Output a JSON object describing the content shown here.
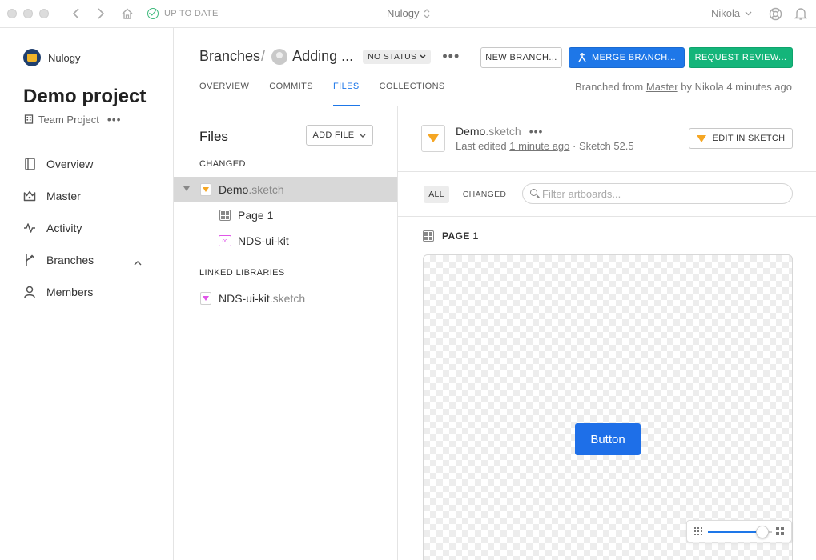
{
  "titlebar": {
    "status": "UP TO DATE",
    "org_name": "Nulogy",
    "user_name": "Nikola"
  },
  "sidebar": {
    "org_name": "Nulogy",
    "project_title": "Demo project",
    "project_type": "Team Project",
    "nav": [
      {
        "label": "Overview",
        "icon": "document-icon"
      },
      {
        "label": "Master",
        "icon": "crown-icon"
      },
      {
        "label": "Activity",
        "icon": "activity-icon"
      },
      {
        "label": "Branches",
        "icon": "branch-icon"
      },
      {
        "label": "Members",
        "icon": "person-icon"
      }
    ]
  },
  "header": {
    "breadcrumb_root": "Branches",
    "breadcrumb_branch": "Adding ...",
    "status_label": "NO STATUS",
    "new_branch_label": "NEW BRANCH...",
    "merge_branch_label": "MERGE BRANCH...",
    "request_review_label": "REQUEST REVIEW...",
    "tabs": [
      "OVERVIEW",
      "COMMITS",
      "FILES",
      "COLLECTIONS"
    ],
    "active_tab": "FILES",
    "branched_prefix": "Branched from",
    "branched_source": "Master",
    "branched_suffix": "by Nikola 4 minutes ago"
  },
  "files_panel": {
    "title": "Files",
    "add_file_label": "ADD FILE",
    "changed_label": "CHANGED",
    "changed_file": {
      "name": "Demo",
      "ext": ".sketch"
    },
    "children": [
      {
        "label": "Page 1",
        "icon": "page-icon"
      },
      {
        "label": "NDS-ui-kit",
        "icon": "link-icon"
      }
    ],
    "linked_label": "LINKED LIBRARIES",
    "linked_file": {
      "name": "NDS-ui-kit",
      "ext": ".sketch"
    }
  },
  "document": {
    "name": "Demo",
    "ext": ".sketch",
    "edited_prefix": "Last edited",
    "edited_time": "1 minute ago",
    "version": "· Sketch 52.5",
    "edit_button_label": "EDIT IN SKETCH"
  },
  "filters": {
    "all_label": "ALL",
    "changed_label": "CHANGED",
    "search_placeholder": "Filter artboards..."
  },
  "artboard": {
    "page_label": "PAGE 1",
    "button_label": "Button",
    "zoom_fraction": 0.85
  },
  "colors": {
    "accent": "#1e77e8",
    "success": "#14b57a",
    "sketch_orange": "#f5a623",
    "library_pink": "#e056e8"
  }
}
